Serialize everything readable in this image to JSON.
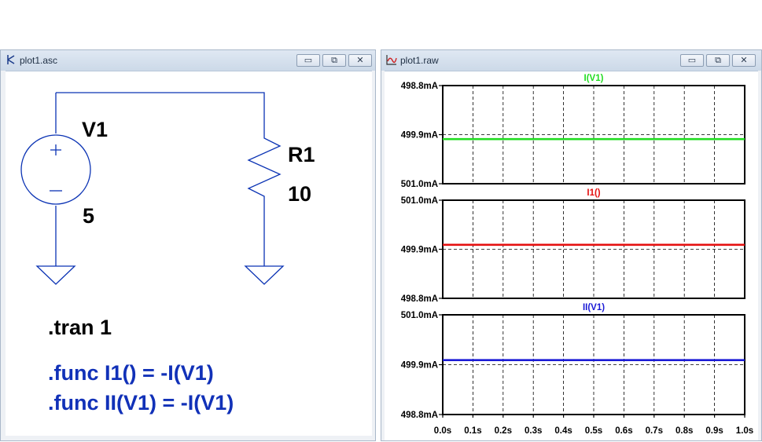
{
  "schematic_window": {
    "title": "plot1.asc",
    "controls": [
      {
        "name": "minimize",
        "glyph": "▭"
      },
      {
        "name": "restore",
        "glyph": "⧉"
      },
      {
        "name": "close",
        "glyph": "✕"
      }
    ],
    "components": {
      "voltage_source": {
        "ref": "V1",
        "value": "5",
        "plus_sign": "+",
        "minus_sign": "−"
      },
      "resistor": {
        "ref": "R1",
        "value": "10"
      }
    },
    "directives": {
      "tran": ".tran 1",
      "func1": ".func I1() = -I(V1)",
      "func2": ".func II(V1) = -I(V1)"
    },
    "colors": {
      "wire": "#0b33b4",
      "directive_blue": "#1131b8",
      "text": "#000000"
    }
  },
  "plot_window": {
    "title": "plot1.raw",
    "controls": [
      {
        "name": "minimize",
        "glyph": "▭"
      },
      {
        "name": "restore",
        "glyph": "⧉"
      },
      {
        "name": "close",
        "glyph": "✕"
      }
    ],
    "x_ticks": [
      "0.0s",
      "0.1s",
      "0.2s",
      "0.3s",
      "0.4s",
      "0.5s",
      "0.6s",
      "0.7s",
      "0.8s",
      "0.9s",
      "1.0s"
    ],
    "panes": [
      {
        "trace_name": "I(V1)",
        "color": "#22dd22",
        "y_ticks": [
          "498.8mA",
          "499.9mA",
          "501.0mA"
        ]
      },
      {
        "trace_name": "I1()",
        "color": "#e41010",
        "y_ticks": [
          "501.0mA",
          "499.9mA",
          "498.8mA"
        ]
      },
      {
        "trace_name": "II(V1)",
        "color": "#1b1bd6",
        "y_ticks": [
          "501.0mA",
          "499.9mA",
          "498.8mA"
        ]
      }
    ]
  },
  "chart_data": {
    "type": "line",
    "x": [
      0.0,
      1.0
    ],
    "xlim": [
      0.0,
      1.0
    ],
    "grid": true,
    "panes": [
      {
        "ylim": [
          498.8,
          501.0
        ],
        "y_inverted": true,
        "series": [
          {
            "name": "I(V1)",
            "x": [
              0.0,
              1.0
            ],
            "values": [
              -500.0,
              -500.0
            ]
          }
        ],
        "y_display": [
          500.0,
          500.0
        ]
      },
      {
        "ylim": [
          498.8,
          501.0
        ],
        "y_inverted": false,
        "series": [
          {
            "name": "I1()",
            "x": [
              0.0,
              1.0
            ],
            "values": [
              500.0,
              500.0
            ]
          }
        ]
      },
      {
        "ylim": [
          498.8,
          501.0
        ],
        "y_inverted": false,
        "series": [
          {
            "name": "II(V1)",
            "x": [
              0.0,
              1.0
            ],
            "values": [
              500.0,
              500.0
            ]
          }
        ]
      }
    ],
    "units": {
      "x": "s",
      "y": "mA"
    }
  }
}
